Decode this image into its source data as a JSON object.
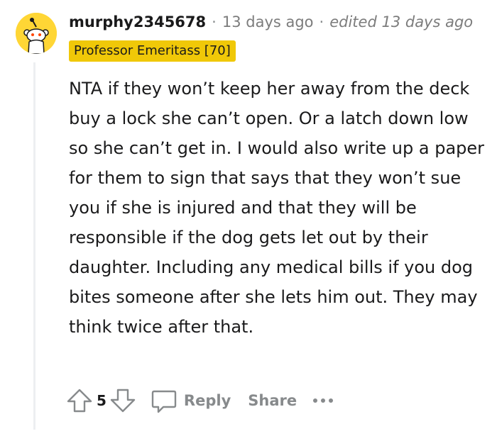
{
  "comment": {
    "author": "murphy2345678",
    "separator": "·",
    "timestamp": "13 days ago",
    "edited": "edited 13 days ago",
    "flair": "Professor Emeritass [70]",
    "body": "NTA if they won’t keep her away from the deck buy a lock she can’t open. Or a latch down low so she can’t get in. I would also write up a paper for them to sign that says that they won’t sue you if she is injured and that they will be responsible if the dog gets let out by their daughter. Including any medical bills if you dog bites someone after she lets him out. They may think twice after that.",
    "score": "5"
  },
  "actions": {
    "reply_label": "Reply",
    "share_label": "Share"
  },
  "icons": {
    "avatar": "snoo-avatar-icon",
    "upvote": "upvote-arrow-icon",
    "downvote": "downvote-arrow-icon",
    "reply": "speech-bubble-icon",
    "more": "more-options-icon"
  },
  "colors": {
    "avatar_bg": "#ffd635",
    "flair_bg": "#f0c808",
    "muted_text": "#878a8c",
    "thread_line": "#edeff1"
  }
}
